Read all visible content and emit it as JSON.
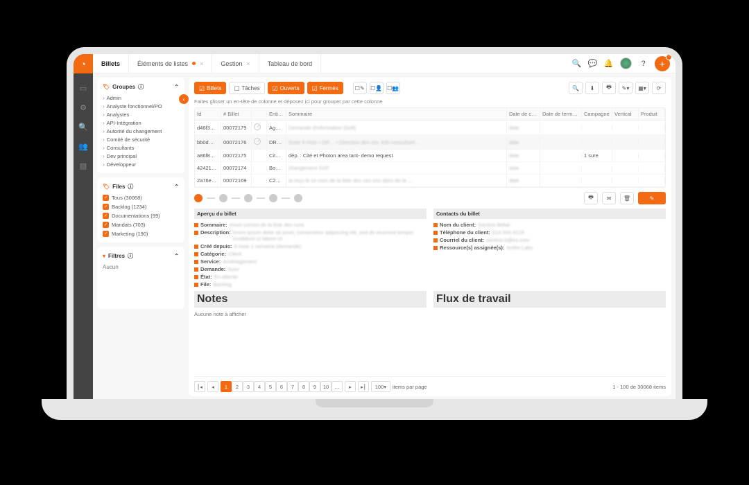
{
  "tabs": [
    {
      "label": "Billets",
      "active": true
    },
    {
      "label": "Éléments de listes",
      "dot": true,
      "close": true
    },
    {
      "label": "Gestion",
      "close": true
    },
    {
      "label": "Tableau de bord"
    }
  ],
  "groups": {
    "title": "Groupes",
    "items": [
      "Admin",
      "Analyste fonctionnel/PO",
      "Analystes",
      "API-Intégration",
      "Autorité du changement",
      "Comité de sécurité",
      "Consultants",
      "Dev principal",
      "Développeur"
    ]
  },
  "files": {
    "title": "Files",
    "items": [
      {
        "label": "Tous",
        "count": "30068"
      },
      {
        "label": "Backlog",
        "count": "1234"
      },
      {
        "label": "Documentations",
        "count": "99"
      },
      {
        "label": "Mandats",
        "count": "703"
      },
      {
        "label": "Marketing",
        "count": "190"
      }
    ]
  },
  "filters": {
    "title": "Filtres",
    "empty": "Aucun"
  },
  "toolbar": {
    "billets": "Billets",
    "taches": "Tâches",
    "ouverts": "Ouverts",
    "fermes": "Fermés"
  },
  "grid": {
    "hint": "Faites glisser un en-tête de colonne et déposez ici pour grouper par cette colonne",
    "cols": [
      "Id",
      "# Billet",
      "",
      "Enti…",
      "Sommaire",
      "Date de cré…",
      "Date de fermeture",
      "Campagne",
      "Vertical",
      "Produit"
    ],
    "rows": [
      {
        "id": "d46f3…",
        "num": "00072179",
        "clock": true,
        "ent": "Ag…",
        "sum": "Demande d'information [Soft]",
        "blur": true
      },
      {
        "id": "bb0d…",
        "num": "00072176",
        "clock": true,
        "ent": "DR…",
        "sum": "Suite 3 mois • DR… • Direction des res. info consultant…",
        "blur": true
      },
      {
        "id": "a86f8…",
        "num": "00072175",
        "clock": false,
        "ent": "Cit…",
        "sum": "dép. : Cité et Photon area tant- demo request",
        "date": "",
        "camp": "1 sure"
      },
      {
        "id": "42421…",
        "num": "00072174",
        "clock": false,
        "ent": "Bo…",
        "sum": "changement SVP",
        "blur": true
      },
      {
        "id": "2a76e…",
        "num": "00072169",
        "clock": false,
        "ent": "C2…",
        "sum": "ai reçu le ce nom de la liste des ces ons alors de la …",
        "blur": true
      }
    ]
  },
  "detail": {
    "left": {
      "title": "Aperçu du billet",
      "rows": [
        {
          "lab": "Sommaire:",
          "val": "envoi correct de la liste des runs"
        },
        {
          "lab": "Description:",
          "val": "lorem ipsum dolor sit amet, consectetur adipiscing elit, sed do eiusmod tempor incididunt ut labore et",
          "long": true
        },
        {
          "lab": "Créé depuis:",
          "val": "6 mois 1 semaine (demande)"
        },
        {
          "lab": "Catégorie:",
          "val": "Client"
        },
        {
          "lab": "Service:",
          "val": "Aménagement"
        },
        {
          "lab": "Demande:",
          "val": "Suivi"
        },
        {
          "lab": "État:",
          "val": "En attente"
        },
        {
          "lab": "File:",
          "val": "Backlog"
        }
      ]
    },
    "right": {
      "title": "Contacts du billet",
      "rows": [
        {
          "lab": "Nom du client:",
          "val": "Santino Belair"
        },
        {
          "lab": "Téléphone du client:",
          "val": "514 555 0123"
        },
        {
          "lab": "Courriel du client:",
          "val": "santino.b@ex.com"
        },
        {
          "lab": "Ressource(s) assignée(s):",
          "val": "Antho Labs"
        }
      ]
    },
    "notes": {
      "title": "Notes",
      "empty": "Aucune note à afficher"
    },
    "flux": {
      "title": "Flux de travail"
    }
  },
  "pager": {
    "pages": [
      "1",
      "2",
      "3",
      "4",
      "5",
      "6",
      "7",
      "8",
      "9",
      "10",
      "…"
    ],
    "active": "1",
    "size": "100",
    "size_label": "items par page",
    "info": "1 - 100 de 30068 items"
  }
}
